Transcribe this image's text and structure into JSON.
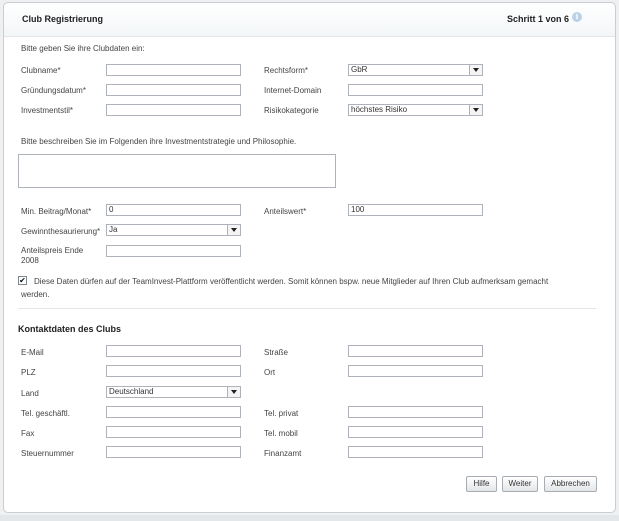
{
  "header": {
    "title": "Club Registrierung",
    "step": "Schritt 1 von 6",
    "info_icon": "info-icon"
  },
  "intro": "Bitte geben Sie ihre Clubdaten ein:",
  "fields": {
    "clubname": {
      "label": "Clubname*",
      "value": ""
    },
    "rechtsform": {
      "label": "Rechtsform*",
      "value": "GbR"
    },
    "gruendungsdatum": {
      "label": "Gründungsdatum*",
      "value": ""
    },
    "internet_domain": {
      "label": "Internet-Domain",
      "value": ""
    },
    "investmentstil": {
      "label": "Investmentstil*",
      "value": ""
    },
    "risikokategorie": {
      "label": "Risikokategorie",
      "value": "höchstes Risiko"
    },
    "strategie_text": "Bitte beschreiben Sie im Folgenden ihre Investmentstrategie und Philosophie.",
    "strategie_value": "",
    "min_beitrag": {
      "label": "Min. Beitrag/Monat*",
      "value": "0"
    },
    "anteilswert": {
      "label": "Anteilswert*",
      "value": "100"
    },
    "gewinnthesaurierung": {
      "label": "Gewinnthesaurierung*",
      "value": "Ja"
    },
    "anteilspreis": {
      "label_line1": "Anteilspreis Ende",
      "label_line2": "2008",
      "value": ""
    }
  },
  "publish": {
    "checked": true,
    "check_mark": "✔",
    "line1": "Diese Daten dürfen auf der TeamInvest-Plattform veröffentlicht werden. Somit können bspw. neue Mitglieder auf Ihren Club aufmerksam gemacht",
    "line2": "werden."
  },
  "contact": {
    "title": "Kontaktdaten des Clubs",
    "email": {
      "label": "E-Mail",
      "value": ""
    },
    "strasse": {
      "label": "Straße",
      "value": ""
    },
    "plz": {
      "label": "PLZ",
      "value": ""
    },
    "ort": {
      "label": "Ort",
      "value": ""
    },
    "land": {
      "label": "Land",
      "value": "Deutschland"
    },
    "tel_geschaeftl": {
      "label": "Tel. geschäftl.",
      "value": ""
    },
    "tel_privat": {
      "label": "Tel. privat",
      "value": ""
    },
    "fax": {
      "label": "Fax",
      "value": ""
    },
    "tel_mobil": {
      "label": "Tel. mobil",
      "value": ""
    },
    "steuernummer": {
      "label": "Steuernummer",
      "value": ""
    },
    "finanzamt": {
      "label": "Finanzamt",
      "value": ""
    }
  },
  "buttons": {
    "hilfe": "Hilfe",
    "weiter": "Weiter",
    "abbrechen": "Abbrechen"
  }
}
